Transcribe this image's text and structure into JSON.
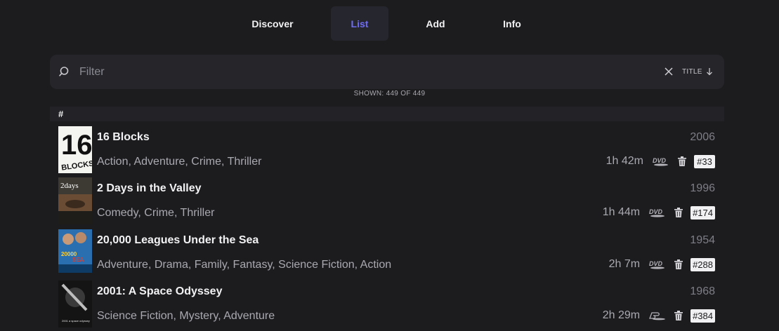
{
  "tabs": [
    {
      "label": "Discover",
      "active": false
    },
    {
      "label": "List",
      "active": true
    },
    {
      "label": "Add",
      "active": false
    },
    {
      "label": "Info",
      "active": false
    }
  ],
  "filter": {
    "placeholder": "Filter",
    "value": "",
    "sort_label": "TITLE",
    "sort_direction": "descending"
  },
  "shown_text": "SHOWN: 449 OF 449",
  "list_header": "#",
  "colors": {
    "accent": "#6f6cf4",
    "background": "#1c1c1f",
    "badge_bg": "#f0f0f2"
  },
  "movies": [
    {
      "title": "16 Blocks",
      "year": "2006",
      "genres": "Action, Adventure, Crime, Thriller",
      "runtime": "1h 42m",
      "media": "DVD",
      "media_icon": "dvd-icon",
      "number": "#33"
    },
    {
      "title": "2 Days in the Valley",
      "year": "1996",
      "genres": "Comedy, Crime, Thriller",
      "runtime": "1h 44m",
      "media": "DVD",
      "media_icon": "dvd-icon",
      "number": "#174"
    },
    {
      "title": "20,000 Leagues Under the Sea",
      "year": "1954",
      "genres": "Adventure, Drama, Family, Fantasy, Science Fiction, Action",
      "runtime": "2h 7m",
      "media": "DVD",
      "media_icon": "dvd-icon",
      "number": "#288"
    },
    {
      "title": "2001: A Space Odyssey",
      "year": "1968",
      "genres": "Science Fiction, Mystery, Adventure",
      "runtime": "2h 29m",
      "media": "Blu-ray",
      "media_icon": "bluray-icon",
      "number": "#384"
    }
  ]
}
